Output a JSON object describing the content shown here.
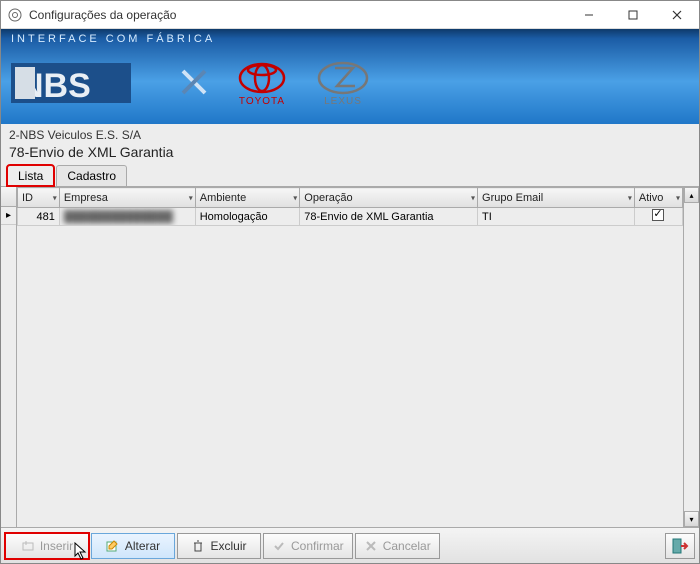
{
  "window": {
    "title": "Configurações da operação"
  },
  "banner": {
    "label": "INTERFACE COM FÁBRICA",
    "brand_toyota": "TOYOTA",
    "brand_lexus": "LEXUS"
  },
  "subheader": {
    "org": "2-NBS Veiculos E.S. S/A",
    "operation": "78-Envio de XML Garantia"
  },
  "tabs": {
    "lista": "Lista",
    "cadastro": "Cadastro",
    "active": "lista"
  },
  "grid": {
    "columns": {
      "id": "ID",
      "empresa": "Empresa",
      "ambiente": "Ambiente",
      "operacao": "Operação",
      "grupo_email": "Grupo Email",
      "ativo": "Ativo"
    },
    "rows": [
      {
        "id": "481",
        "empresa": "██████████████",
        "ambiente": "Homologação",
        "operacao": "78-Envio de XML Garantia",
        "grupo_email": "TI",
        "ativo": true
      }
    ]
  },
  "toolbar": {
    "inserir": "Inserir",
    "alterar": "Alterar",
    "excluir": "Excluir",
    "confirmar": "Confirmar",
    "cancelar": "Cancelar"
  }
}
